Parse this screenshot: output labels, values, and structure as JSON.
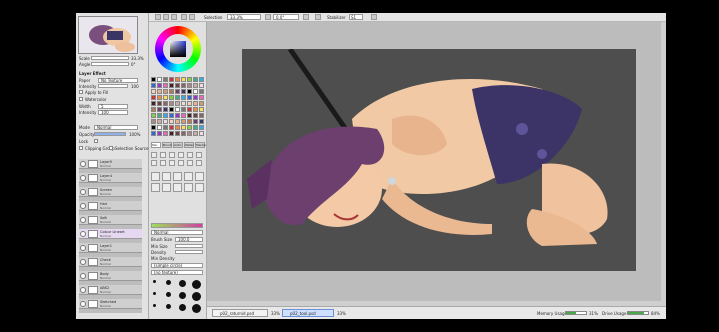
{
  "toolbar": {
    "selection_label": "Selection",
    "zoom_value": "33.3%",
    "angle_value": "0.0°",
    "stabilizer_label": "Stabilizer",
    "stabilizer_value": "S1"
  },
  "nav": {
    "scale_label": "Scale",
    "scale_value": "33.3%",
    "angle_label": "Angle",
    "angle_value": "0°"
  },
  "layer_props": {
    "effect_header": "Layer Effect",
    "paper_label": "Paper",
    "paper_value": "No Texture",
    "intensity_label": "Intensity",
    "intensity_value": "100",
    "apply_label": "Apply to Fill",
    "watercolor_label": "Watercolor",
    "width_label": "Width",
    "width_value": "5",
    "strength_label": "Intensity",
    "strength_value": "100",
    "mode_label": "Mode",
    "mode_value": "Normal",
    "opacity_label": "Opacity",
    "opacity_value": "100%",
    "lock_label": "Lock",
    "clipping_label": "Clipping Group",
    "selection_source_label": "Selection Source"
  },
  "layers": [
    {
      "name": "Layer5",
      "mode": "Normal"
    },
    {
      "name": "Layer4",
      "mode": "Normal"
    },
    {
      "name": "Screen",
      "mode": "Normal"
    },
    {
      "name": "Hair",
      "mode": "Normal"
    },
    {
      "name": "Soft",
      "mode": "Normal"
    },
    {
      "name": "Colour Lineart",
      "mode": "Normal"
    },
    {
      "name": "Layer1",
      "mode": "Normal"
    },
    {
      "name": "Check",
      "mode": "Normal"
    },
    {
      "name": "Body",
      "mode": "Normal"
    },
    {
      "name": "ABS2",
      "mode": "Normal"
    },
    {
      "name": "Sketched",
      "mode": "Normal"
    }
  ],
  "tools": {
    "tabs": [
      "Pen",
      "Brush",
      "Airbr.",
      "Water",
      "Marker"
    ],
    "blend_value": "Normal",
    "brush_size_label": "Brush Size",
    "brush_size_value": "100.0",
    "min_size_label": "Min Size",
    "min_size_value": "0%",
    "density_label": "Density",
    "density_value": "100",
    "min_density_label": "Min Density",
    "shape_value": "(simple circle)",
    "texture_value": "(no texture)"
  },
  "taskbar": {
    "file1": "p02_raturnid.psd",
    "file1_zoom": "33%",
    "file2": "p02_tool.psd",
    "file2_zoom": "33%",
    "memory_label": "Memory Usage",
    "memory_pct": 0.5,
    "memory_value": "31%",
    "disk_label": "Drive Usage",
    "disk_pct": 0.8,
    "disk_value": "84%"
  },
  "colors": {
    "canvas_bg": "#4e4e4e",
    "accent": "#2a3bd8",
    "active_task": "#cfe0ff"
  }
}
